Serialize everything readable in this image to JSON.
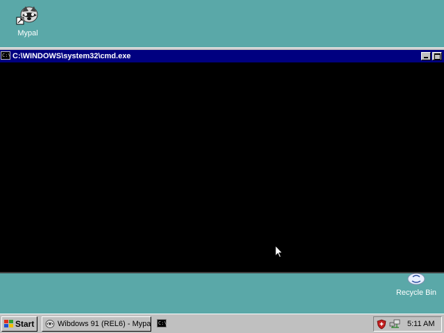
{
  "desktop": {
    "icons": [
      {
        "label": "Mypal",
        "icon": "mypal-browser-icon"
      },
      {
        "label": "Recycle Bin",
        "icon": "recycle-bin-icon"
      }
    ]
  },
  "window": {
    "title": "C:\\WINDOWS\\system32\\cmd.exe",
    "system_icon_text": "C:\\",
    "console_text": ""
  },
  "taskbar": {
    "start_label": "Start",
    "tasks": [
      {
        "label": "Wibdows 91 (REL6) - Mypal",
        "icon": "mypal-browser-icon"
      },
      {
        "label": "",
        "icon": "cmd-icon",
        "icon_text": "C:\\"
      }
    ],
    "tray": {
      "icons": [
        "shield-icon",
        "network-icon"
      ],
      "clock": "5:11 AM"
    }
  },
  "colors": {
    "desktop": "#5aa8a8",
    "titlebar": "#000080",
    "console": "#000000",
    "chrome": "#c0c0c0"
  }
}
